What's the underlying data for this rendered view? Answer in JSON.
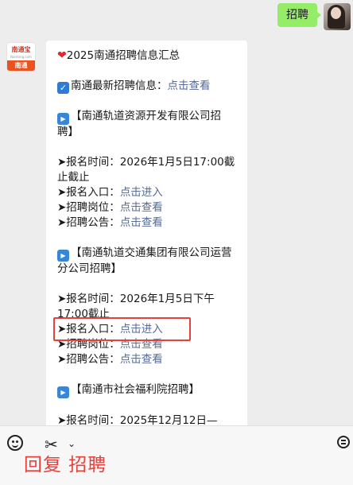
{
  "user_message": "招聘",
  "bot_logo": {
    "top": "南通宝",
    "sub": "Nantong.com",
    "bottom": "南通"
  },
  "message": {
    "title": "2025南通招聘信息汇总",
    "latest_label": "南通最新招聘信息：",
    "latest_link": "点击查看",
    "sections": [
      {
        "title_line1": "【南通轨道资源开发有限公司招",
        "title_line2": "聘】",
        "time_label": "➤报名时间：2026年1月5日17:00截",
        "time_cont": "止截止",
        "entry_label": "➤报名入口：",
        "entry_link": "点击进入",
        "post_label": "➤招聘岗位：",
        "post_link": "点击查看",
        "notice_label": "➤招聘公告：",
        "notice_link": "点击查看"
      },
      {
        "title_line1": "【南通轨道交通集团有限公司运营",
        "title_line2": "分公司招聘】",
        "time_label": "➤报名时间：2026年1月5日下午",
        "time_cont": "17:00截止",
        "entry_label": "➤报名入口：",
        "entry_link": "点击进入",
        "post_label": "➤招聘岗位：",
        "post_link": "点击查看",
        "notice_label": "➤招聘公告：",
        "notice_link": "点击查看"
      },
      {
        "title_line1": "【南通市社会福利院招聘】",
        "time_label": "➤报名时间：2025年12月12日—"
      }
    ]
  },
  "reply_hint": "回复 招聘",
  "colors": {
    "link": "#576b95",
    "highlight": "#e8403a",
    "my_bubble": "#95ec69"
  }
}
